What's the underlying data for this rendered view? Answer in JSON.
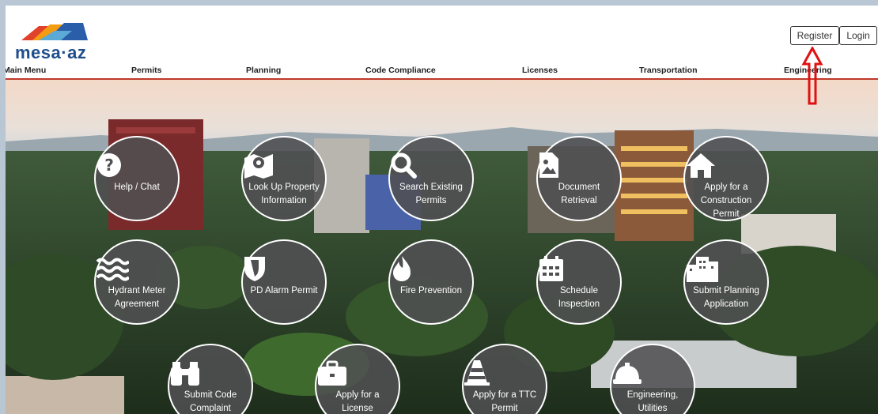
{
  "header": {
    "logo_text": "mesa·az",
    "register_label": "Register",
    "login_label": "Login"
  },
  "nav": {
    "items": [
      "Main Menu",
      "Permits",
      "Planning",
      "Code Compliance",
      "Licenses",
      "Transportation",
      "Engineering"
    ]
  },
  "tiles": [
    {
      "label": "Help / Chat",
      "icon": "question-icon"
    },
    {
      "label": "Look Up Property Information",
      "icon": "map-marker-icon"
    },
    {
      "label": "Search Existing Permits",
      "icon": "search-icon"
    },
    {
      "label": "Document Retrieval",
      "icon": "document-image-icon"
    },
    {
      "label": "Apply for a Construction Permit",
      "icon": "house-icon"
    },
    {
      "label": "Hydrant Meter Agreement",
      "icon": "water-icon"
    },
    {
      "label": "PD Alarm Permit",
      "icon": "shield-icon"
    },
    {
      "label": "Fire Prevention",
      "icon": "fire-icon"
    },
    {
      "label": "Schedule Inspection",
      "icon": "calendar-icon"
    },
    {
      "label": "Submit Planning Application",
      "icon": "buildings-icon"
    },
    {
      "label": "Submit Code Complaint",
      "icon": "binoculars-icon"
    },
    {
      "label": "Apply for a License",
      "icon": "briefcase-icon"
    },
    {
      "label": "Apply for a TTC Permit",
      "icon": "traffic-cone-icon"
    },
    {
      "label": "Engineering, Utilities",
      "icon": "hard-hat-icon"
    }
  ],
  "colors": {
    "nav_underline": "#c0392b",
    "tile_fill": "#505052",
    "annotation_arrow": "#e01010"
  }
}
